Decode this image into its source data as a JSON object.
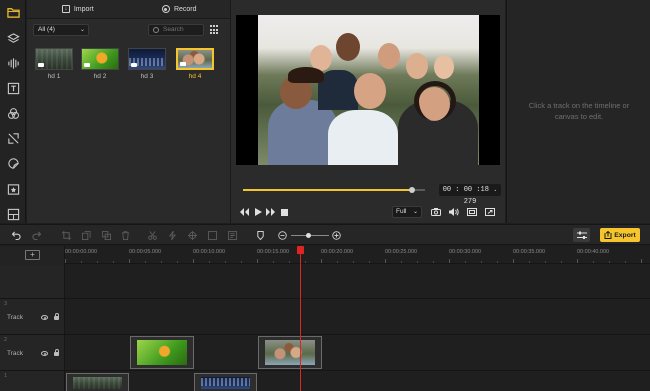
{
  "media": {
    "import_label": "Import",
    "record_label": "Record",
    "filter_value": "All (4)",
    "search_placeholder": "Search",
    "items": [
      {
        "label": "hd 1"
      },
      {
        "label": "hd 2"
      },
      {
        "label": "hd 3"
      },
      {
        "label": "hd 4",
        "selected": true
      }
    ]
  },
  "preview": {
    "timecode": "00 : 00 :18 . 279",
    "quality": "Full",
    "progress": 0.93
  },
  "properties": {
    "hint_line1": "Click a track on the timeline or",
    "hint_line2": "canvas to edit."
  },
  "toolbar": {
    "export_label": "Export",
    "zoom_level": 0.45
  },
  "timeline": {
    "ticks": [
      "00:00:00.000",
      "00:00:05.000",
      "00:00:10.000",
      "00:00:15.000",
      "00:00:20.000",
      "00:00:25.000",
      "00:00:30.000",
      "00:00:35.000",
      "00:00:40.000"
    ],
    "tracks": [
      {
        "number": "3",
        "name": "Track"
      },
      {
        "number": "2",
        "name": "Track"
      },
      {
        "number": "1",
        "name": ""
      }
    ]
  },
  "colors": {
    "accent": "#f6c52e",
    "playhead": "#e02424",
    "background": "#1e1e1e"
  },
  "icons": [
    "folder-icon",
    "layers-icon",
    "audio-wave-icon",
    "text-icon",
    "filters-icon",
    "transitions-icon",
    "stickers-icon",
    "elements-icon",
    "templates-icon"
  ]
}
